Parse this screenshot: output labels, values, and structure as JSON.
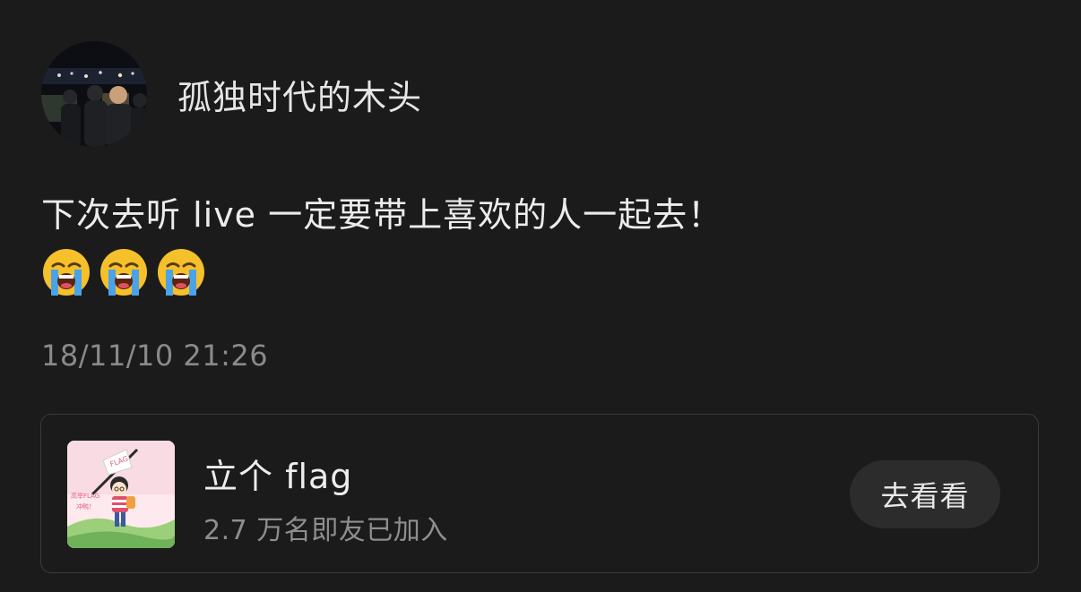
{
  "post": {
    "author": "孤独时代的木头",
    "text": "下次去听 live 一定要带上喜欢的人一起去！",
    "emojis": [
      "loudly-crying-face-icon",
      "loudly-crying-face-icon",
      "loudly-crying-face-icon"
    ],
    "timestamp": "18/11/10 21:26"
  },
  "flag_card": {
    "title": "立个 flag",
    "subtitle": "2.7 万名即友已加入",
    "button_label": "去看看",
    "thumbnail_text": [
      "FLAG",
      "高举FLAG",
      "冲鸭！"
    ]
  },
  "colors": {
    "background": "#1b1b1b",
    "text_primary": "#ececec",
    "text_secondary": "#8a8a8a",
    "card_border": "#3a3a3a",
    "button_bg": "#2c2c2c"
  }
}
